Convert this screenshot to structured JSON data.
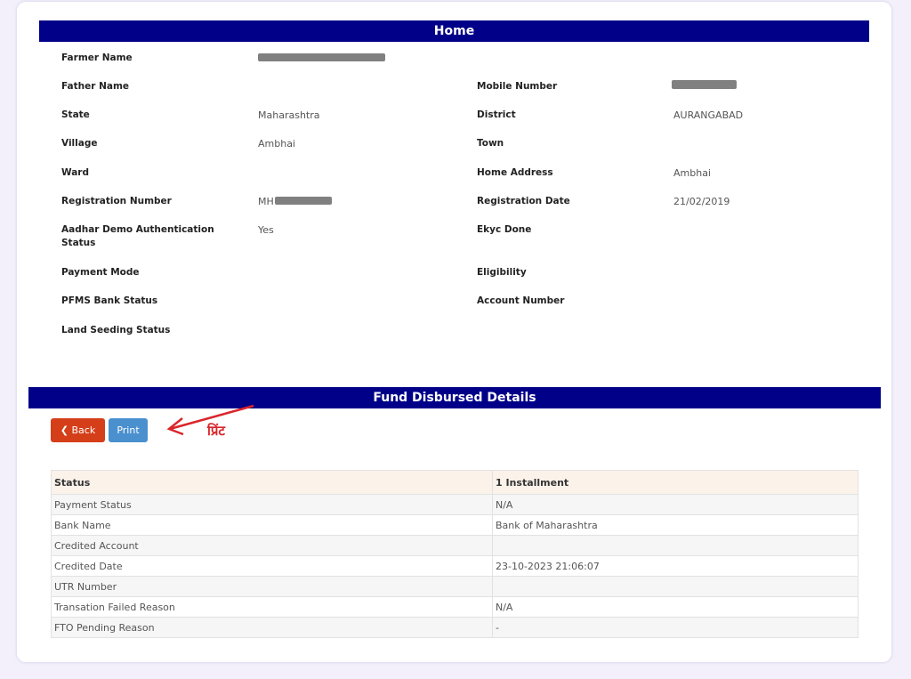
{
  "home": {
    "title": "Home",
    "left_fields": [
      {
        "label": "Farmer Name",
        "value": "",
        "redacted": true
      },
      {
        "label": "Father Name",
        "value": ""
      },
      {
        "label": "State",
        "value": "Maharashtra"
      },
      {
        "label": "Village",
        "value": "Ambhai"
      },
      {
        "label": "Ward",
        "value": ""
      },
      {
        "label": "Registration Number",
        "value": "MH",
        "redacted": true
      },
      {
        "label": "Aadhar Demo Authentication Status",
        "value": "Yes"
      },
      {
        "label": "Payment Mode",
        "value": ""
      },
      {
        "label": "PFMS Bank Status",
        "value": ""
      },
      {
        "label": "Land Seeding Status",
        "value": ""
      }
    ],
    "right_fields": [
      {
        "label": "Mobile Number",
        "value": "",
        "redacted": true
      },
      {
        "label": "District",
        "value": "AURANGABAD"
      },
      {
        "label": "Town",
        "value": ""
      },
      {
        "label": "Home Address",
        "value": "Ambhai"
      },
      {
        "label": "Registration Date",
        "value": "21/02/2019"
      },
      {
        "label": "Ekyc Done",
        "value": ""
      },
      {
        "label": "Eligibility",
        "value": ""
      },
      {
        "label": "Account Number",
        "value": ""
      }
    ]
  },
  "fund": {
    "title": "Fund Disbursed Details",
    "back_label": "Back",
    "back_icon": "chevron-left-icon",
    "print_label": "Print",
    "annotation": "प्रिंट",
    "table": {
      "headers": [
        "Status",
        "1 Installment"
      ],
      "rows": [
        [
          "Payment Status",
          "N/A"
        ],
        [
          "Bank Name",
          "Bank of Maharashtra"
        ],
        [
          "Credited Account",
          ""
        ],
        [
          "Credited Date",
          "23-10-2023 21:06:07"
        ],
        [
          "UTR Number",
          ""
        ],
        [
          "Transation Failed Reason",
          "N/A"
        ],
        [
          "FTO Pending Reason",
          "-"
        ]
      ]
    }
  },
  "colors": {
    "banner": "#000088",
    "back_button": "#d43f1a",
    "print_button": "#4a90cf",
    "annotation": "#d9262b"
  }
}
